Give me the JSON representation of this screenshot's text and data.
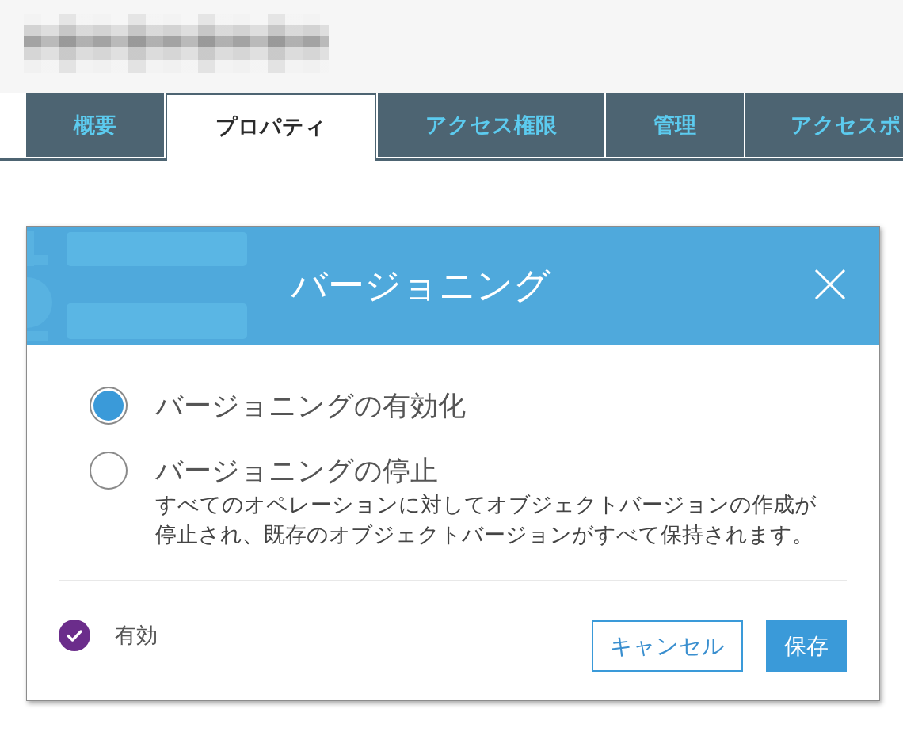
{
  "tabs": [
    {
      "label": "概要",
      "selected": false
    },
    {
      "label": "プロパティ",
      "selected": true
    },
    {
      "label": "アクセス権限",
      "selected": false
    },
    {
      "label": "管理",
      "selected": false
    },
    {
      "label": "アクセスポ",
      "selected": false
    }
  ],
  "dialog": {
    "title": "バージョニング",
    "options": [
      {
        "label": "バージョニングの有効化",
        "selected": true
      },
      {
        "label": "バージョニングの停止",
        "selected": false,
        "description": "すべてのオペレーションに対してオブジェクトバージョンの作成が停止され、既存のオブジェクトバージョンがすべて保持されます。"
      }
    ],
    "status": {
      "label": "有効"
    },
    "buttons": [
      {
        "label": "キャンセル",
        "kind": "secondary"
      },
      {
        "label": "保存",
        "kind": "primary"
      }
    ]
  }
}
